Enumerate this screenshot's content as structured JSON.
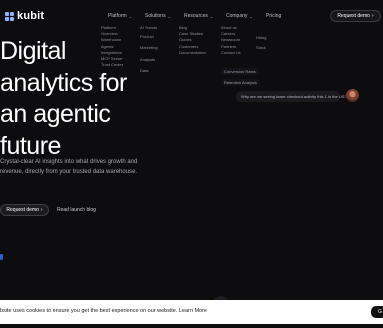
{
  "brand": {
    "name": "kubit",
    "icon": "kubit-logo-icon"
  },
  "nav": {
    "items": [
      {
        "label": "Platform",
        "has_caret": true
      },
      {
        "label": "Solutions",
        "has_caret": true
      },
      {
        "label": "Resources",
        "has_caret": true
      },
      {
        "label": "Company",
        "has_caret": true
      },
      {
        "label": "Pricing",
        "has_caret": false
      }
    ],
    "cta_label": "Request demo",
    "cta_arrow": "›"
  },
  "menus": {
    "platform": [
      "Platform",
      "Overview",
      "Warehouse",
      "Agents",
      "Integrations",
      "MCP Server",
      "Trust Center"
    ],
    "solutions": [
      "AI Trends",
      "Product",
      "Marketing",
      "Analysts",
      "Data"
    ],
    "resources": [
      "Blog",
      "Case Studies",
      "Guides",
      "Customers",
      "Documentation"
    ],
    "company": [
      "About us",
      "Careers",
      "Newsroom",
      "Partners",
      "Contact Us"
    ],
    "pricing": [
      "Hiring",
      "Slack"
    ]
  },
  "hero": {
    "title_lines": [
      "Digital",
      "analytics for",
      "an agentic",
      "future"
    ],
    "subtitle": "Crystal-clear AI insights into what drives growth and revenue, directly from your trusted data warehouse.",
    "primary_label": "Request demo",
    "primary_arrow": "›",
    "secondary_label": "Read launch blog"
  },
  "visual": {
    "pills": [
      "Conversion Rates",
      "Retention Analysis"
    ],
    "chat_message": "Why are we seeing lower checkout activity this 1 in the US?"
  },
  "cookie": {
    "text": "bsite uses cookies to ensure you get the best experience on our website. Learn More",
    "button_label": "G"
  },
  "colors": {
    "background": "#0d0d0f",
    "logo_accent": "#8ab4ff",
    "side_marker": "#2c5fd1",
    "cookie_bar": "#ffffff"
  }
}
